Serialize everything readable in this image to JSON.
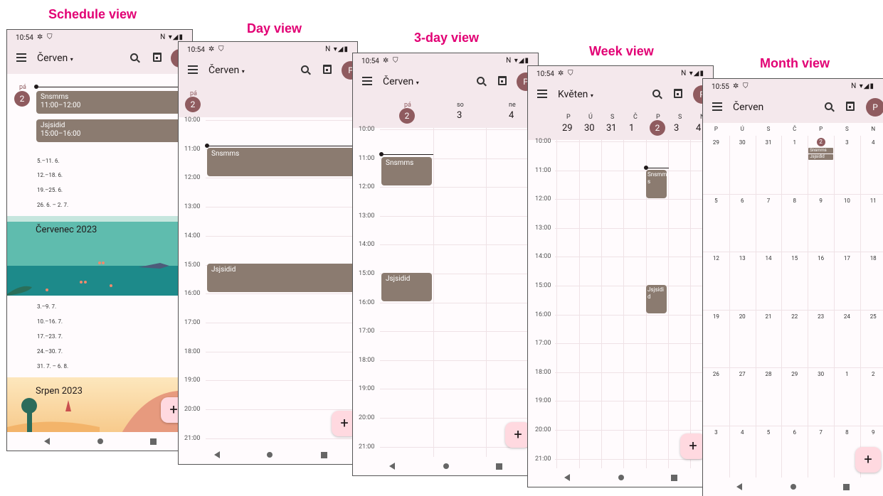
{
  "titles": {
    "schedule": "Schedule view",
    "day": "Day view",
    "three_day": "3-day view",
    "week": "Week view",
    "month": "Month view"
  },
  "status": {
    "time_a": "10:54",
    "time_b": "10:55",
    "settings_icon": "✲",
    "shield_icon": "⛉",
    "right_icons": "N ▾◢▮"
  },
  "appbar": {
    "month_cerven": "Červen",
    "month_kveten": "Květen",
    "avatar": "P",
    "dropdown": "▾"
  },
  "schedule": {
    "day_label": "pá",
    "day_num": "2",
    "events": [
      {
        "title": "Snsmms",
        "time": "11:00–12:00"
      },
      {
        "title": "Jsjsidid",
        "time": "15:00–16:00"
      }
    ],
    "weeks_a": [
      "5.–11. 6.",
      "12.–18. 6.",
      "19.–25. 6.",
      "26. 6. – 2. 7."
    ],
    "banner_july": "Červenec 2023",
    "weeks_b": [
      "3.–9. 7.",
      "10.–16. 7.",
      "17.–23. 7.",
      "24.–30. 7.",
      "31. 7. – 6. 8."
    ],
    "banner_aug": "Srpen 2023"
  },
  "day": {
    "day_label": "pá",
    "day_num": "2",
    "hours": [
      "10:00",
      "11:00",
      "12:00",
      "13:00",
      "14:00",
      "15:00",
      "16:00",
      "17:00",
      "18:00",
      "19:00",
      "20:00",
      "21:00"
    ],
    "events": [
      "Snsmms",
      "Jsjsidid"
    ]
  },
  "three": {
    "days": [
      {
        "label": "pá",
        "num": "2"
      },
      {
        "label": "so",
        "num": "3"
      },
      {
        "label": "ne",
        "num": "4"
      }
    ],
    "hours": [
      "10:00",
      "11:00",
      "12:00",
      "13:00",
      "14:00",
      "15:00",
      "16:00",
      "17:00",
      "18:00",
      "19:00",
      "20:00",
      "21:00"
    ],
    "events": [
      "Snsmms",
      "Jsjsidid"
    ]
  },
  "week": {
    "letters": [
      "P",
      "Ú",
      "S",
      "Č",
      "P",
      "S",
      "N"
    ],
    "nums": [
      "29",
      "30",
      "31",
      "1",
      "2",
      "3",
      "4"
    ],
    "hours": [
      "10:00",
      "11:00",
      "12:00",
      "13:00",
      "14:00",
      "15:00",
      "16:00",
      "17:00",
      "18:00",
      "19:00",
      "20:00",
      "21:00"
    ],
    "events": [
      "Snsmm s",
      "Jsjsidi d"
    ]
  },
  "month": {
    "letters": [
      "P",
      "Ú",
      "S",
      "Č",
      "P",
      "S",
      "N"
    ],
    "rows": [
      [
        "29",
        "30",
        "31",
        "1",
        "2",
        "3",
        "4"
      ],
      [
        "5",
        "6",
        "7",
        "8",
        "9",
        "10",
        "11"
      ],
      [
        "12",
        "13",
        "14",
        "15",
        "16",
        "17",
        "18"
      ],
      [
        "19",
        "20",
        "21",
        "22",
        "23",
        "24",
        "25"
      ],
      [
        "26",
        "27",
        "28",
        "29",
        "30",
        "1",
        "2"
      ],
      [
        "3",
        "4",
        "5",
        "6",
        "7",
        "8",
        "9"
      ]
    ],
    "chips": [
      "Snsmms",
      "Jsjsidid"
    ]
  },
  "fab": "+"
}
